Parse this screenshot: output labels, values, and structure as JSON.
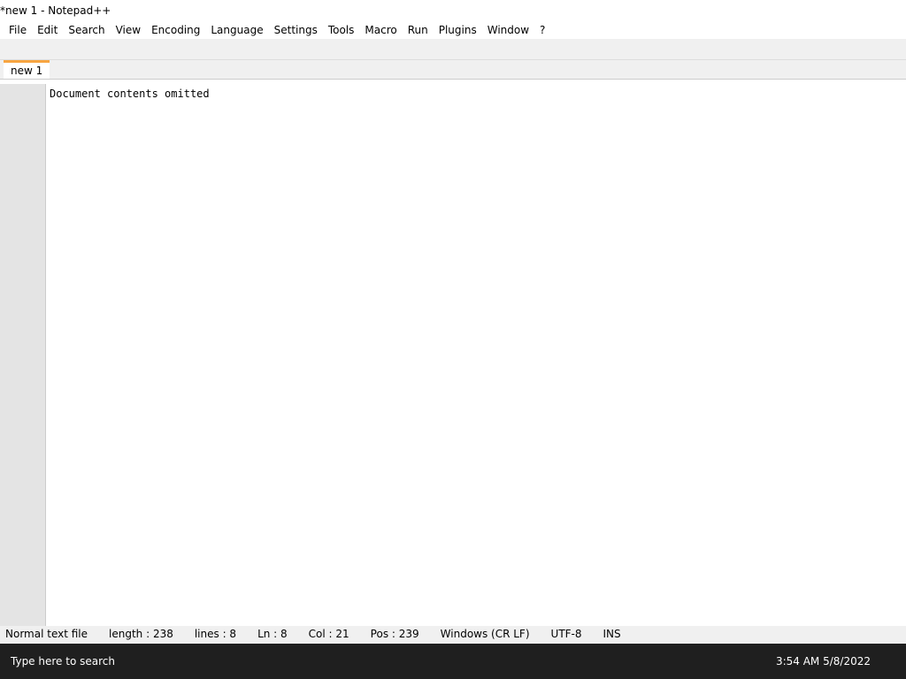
{
  "window": {
    "title": "*new 1 - Notepad++"
  },
  "menu": [
    "File",
    "Edit",
    "Search",
    "View",
    "Encoding",
    "Language",
    "Settings",
    "Tools",
    "Macro",
    "Run",
    "Plugins",
    "Window",
    "?"
  ],
  "tab": {
    "label": "new 1"
  },
  "editor": {
    "note": "Document contents omitted"
  },
  "status": {
    "type": "Normal text file",
    "length": "length : 238",
    "lines": "lines : 8",
    "ln": "Ln : 8",
    "col": "Col : 21",
    "pos": "Pos : 239",
    "eol": "Windows (CR LF)",
    "encoding": "UTF-8",
    "mode": "INS"
  },
  "taskbar": {
    "search_placeholder": "Type here to search",
    "time": "3:54 AM",
    "date": "5/8/2022"
  }
}
